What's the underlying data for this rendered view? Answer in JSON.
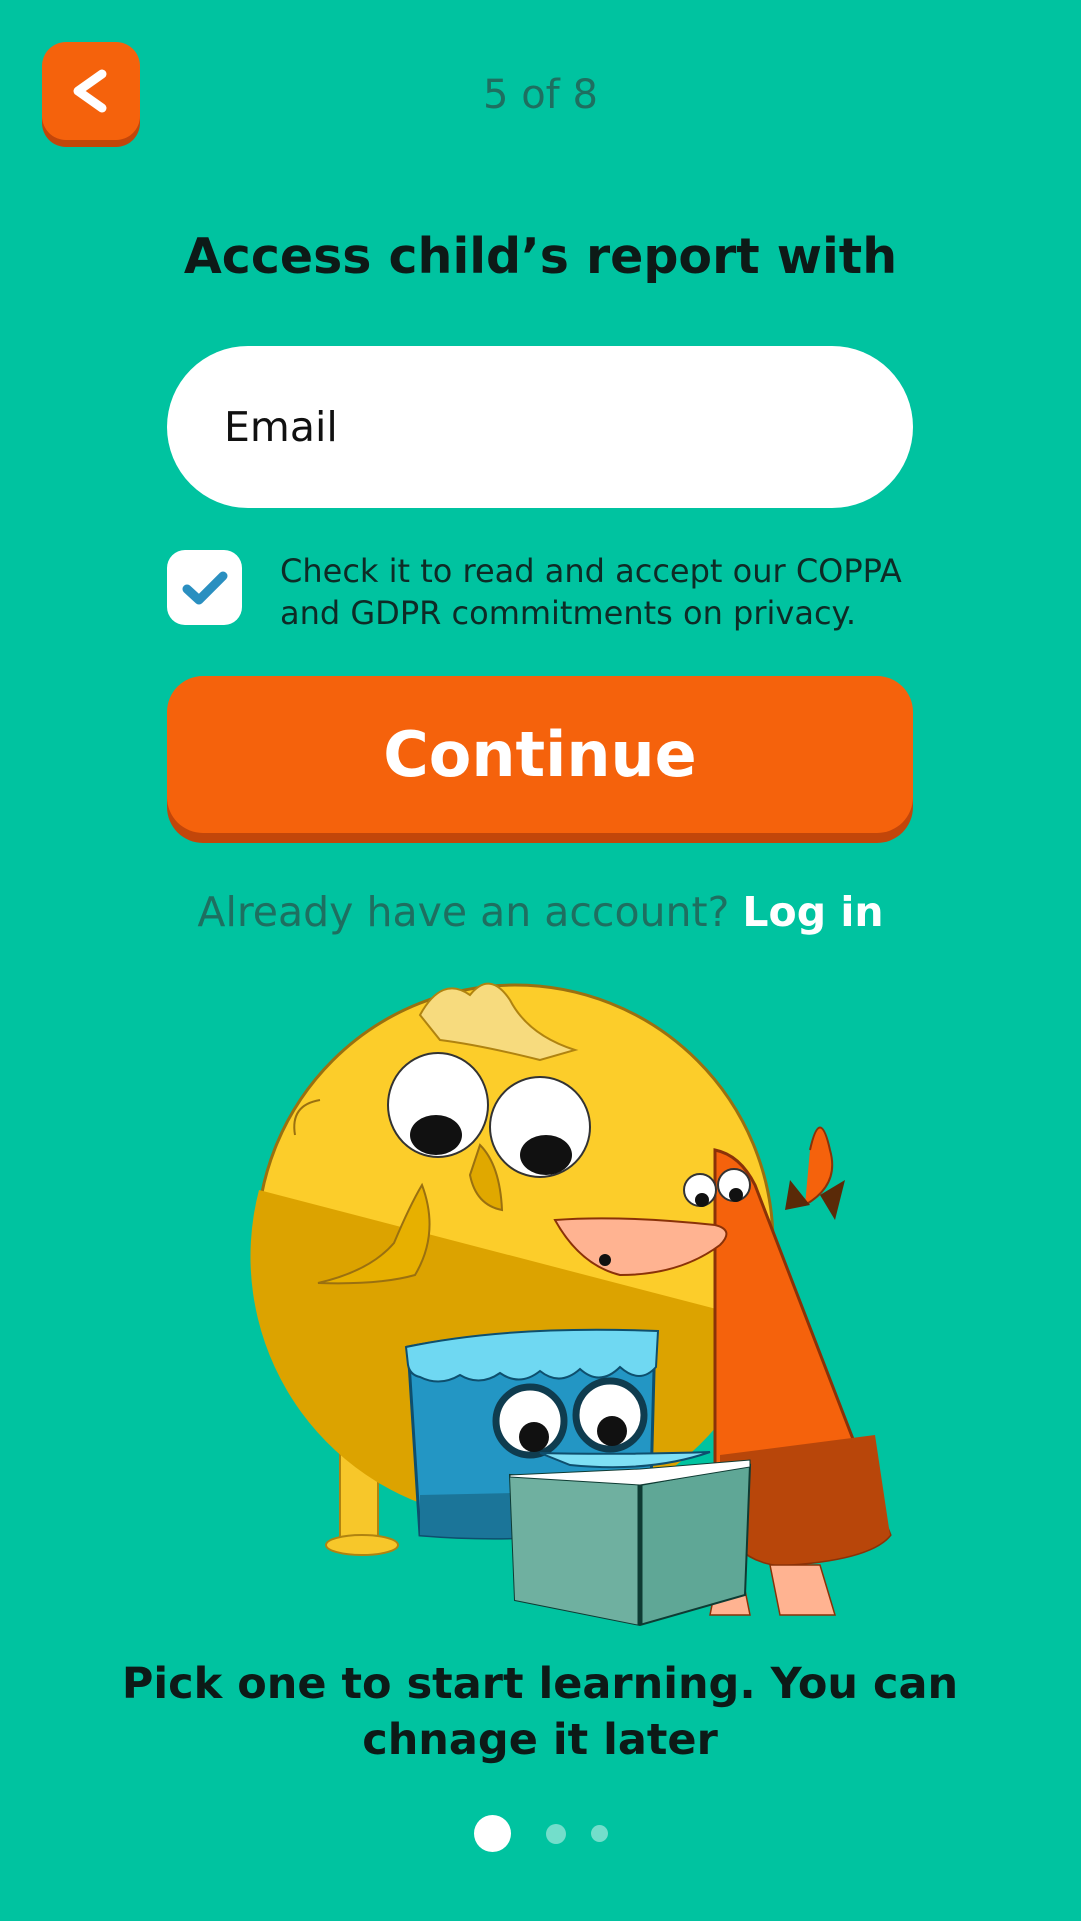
{
  "header": {
    "back_icon": "chevron-left-icon",
    "step_text": "5 of 8"
  },
  "form": {
    "title": "Access child’s report with",
    "email_placeholder": "Email",
    "consent_checked": true,
    "consent_text": "Check it to read and accept our COPPA and GDPR commitments on privacy.",
    "continue_label": "Continue"
  },
  "login": {
    "prompt": "Already have an account?",
    "link": "Log in"
  },
  "illustration": {
    "icon": "reading-characters-illustration"
  },
  "caption": "Pick one to start learning. You can chnage it later",
  "pagination": {
    "total": 3,
    "active_index": 0
  },
  "colors": {
    "background": "#00C3A0",
    "accent": "#F5620C",
    "checkmark": "#2A8FC0"
  }
}
